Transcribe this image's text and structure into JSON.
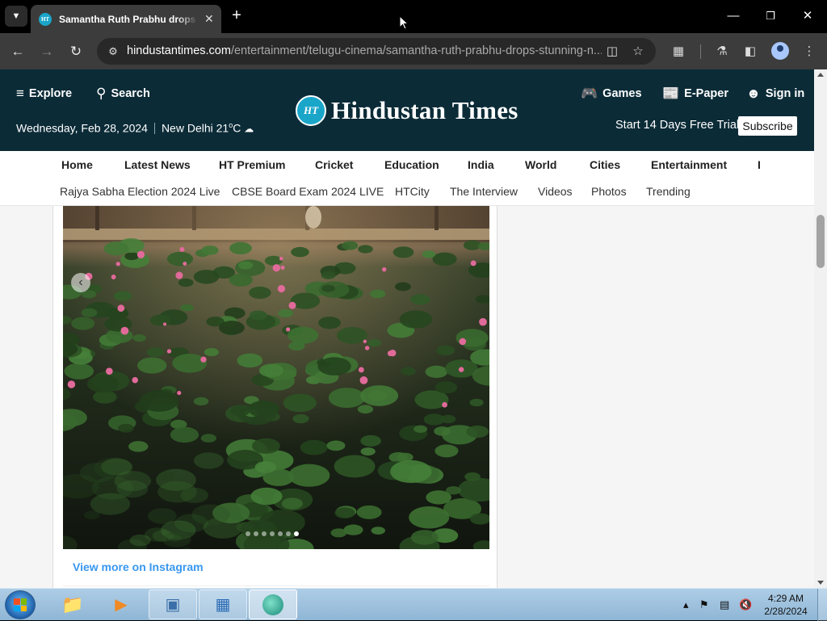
{
  "browser": {
    "tab_title": "Samantha Ruth Prabhu drops stunning new pictures",
    "favicon_text": "HT",
    "url_host": "hindustantimes.com",
    "url_path": "/entertainment/telugu-cinema/samantha-ruth-prabhu-drops-stunning-n..."
  },
  "header": {
    "explore": "Explore",
    "search": "Search",
    "games": "Games",
    "epaper": "E-Paper",
    "signin": "Sign in",
    "date": "Wednesday, Feb 28, 2024",
    "weather_city": "New Delhi 21",
    "weather_unit": "o",
    "weather_c": "C",
    "logo_mark": "HT",
    "logo_text": "Hindustan Times",
    "trial": "Start 14 Days Free Trial",
    "subscribe": "Subscribe"
  },
  "nav_primary": [
    "Home",
    "Latest News",
    "HT Premium",
    "Cricket",
    "Education",
    "India",
    "World",
    "Cities",
    "Entertainment",
    "I"
  ],
  "nav_secondary": [
    "Rajya Sabha Election 2024 Live",
    "CBSE Board Exam 2024 LIVE",
    "HTCity",
    "The Interview",
    "Videos",
    "Photos",
    "Trending"
  ],
  "post": {
    "view_more": "View more on Instagram",
    "carousel_count": 7,
    "carousel_active": 7
  },
  "taskbar": {
    "time": "4:29 AM",
    "date": "2/28/2024"
  },
  "colors": {
    "ht_navy": "#0b2b37",
    "ht_teal": "#1aa6c9",
    "instagram_blue": "#3897f0"
  }
}
